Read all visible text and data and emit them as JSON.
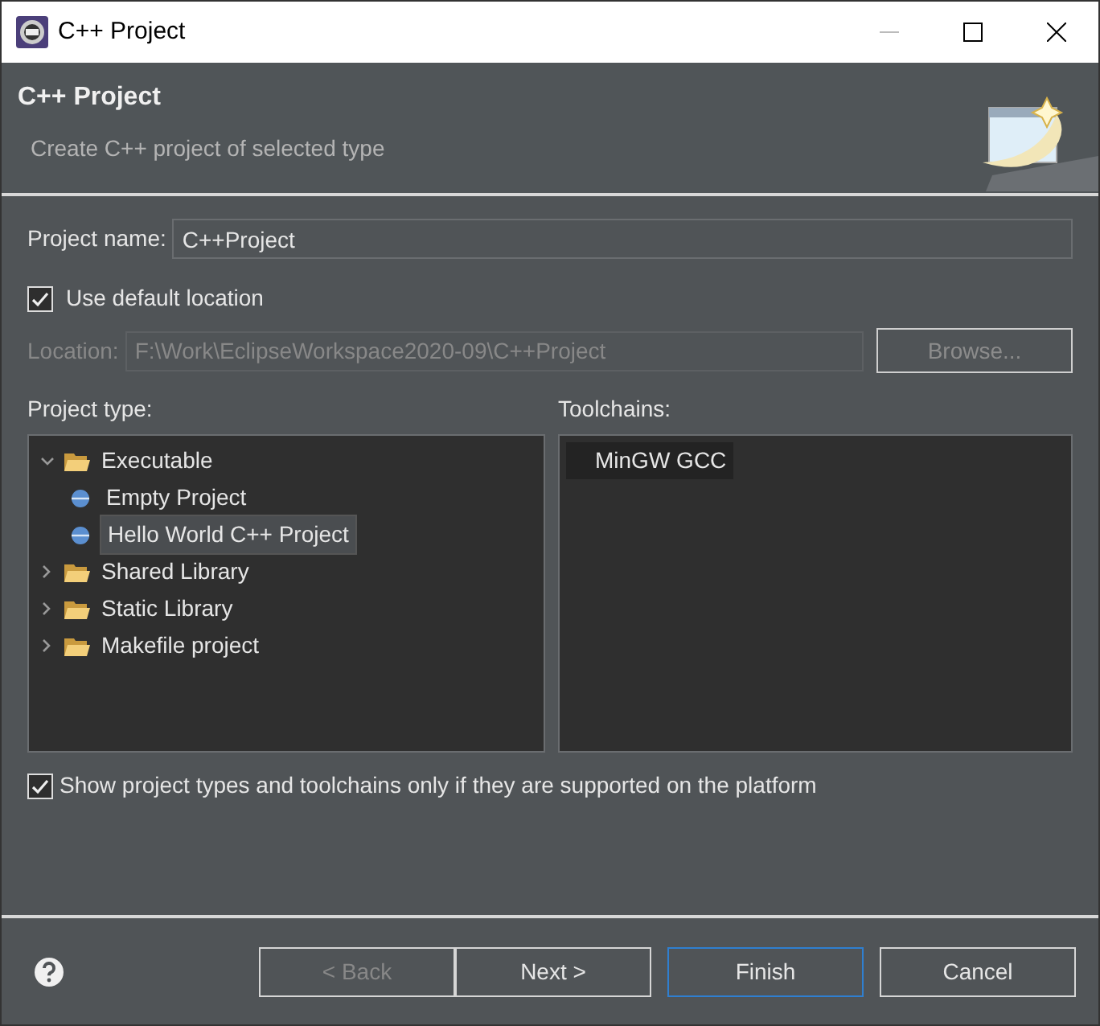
{
  "window": {
    "title": "C++ Project"
  },
  "header": {
    "title": "C++ Project",
    "description": "Create C++ project of selected type"
  },
  "project_name": {
    "label": "Project name:",
    "value": "C++Project"
  },
  "use_default_location": {
    "label": "Use default location",
    "checked": true
  },
  "location": {
    "label": "Location:",
    "value": "F:\\Work\\EclipseWorkspace2020-09\\C++Project",
    "disabled": true,
    "browse": "Browse..."
  },
  "project_type": {
    "label": "Project type:",
    "items": [
      {
        "kind": "folder",
        "label": "Executable",
        "expanded": true,
        "selected": false,
        "children": [
          {
            "kind": "template",
            "label": "Empty Project",
            "selected": false
          },
          {
            "kind": "template",
            "label": "Hello World C++ Project",
            "selected": true
          }
        ]
      },
      {
        "kind": "folder",
        "label": "Shared Library",
        "expanded": false,
        "selected": false
      },
      {
        "kind": "folder",
        "label": "Static Library",
        "expanded": false,
        "selected": false
      },
      {
        "kind": "folder",
        "label": "Makefile project",
        "expanded": false,
        "selected": false
      }
    ]
  },
  "toolchains": {
    "label": "Toolchains:",
    "items": [
      {
        "label": "MinGW GCC",
        "selected": true
      }
    ]
  },
  "show_supported": {
    "label": "Show project types and toolchains only if they are supported on the platform",
    "checked": true
  },
  "buttons": [
    {
      "label": "< Back",
      "disabled": true,
      "default": false
    },
    {
      "label": "Next >",
      "disabled": false,
      "default": false
    },
    {
      "label": "Finish",
      "disabled": false,
      "default": true
    },
    {
      "label": "Cancel",
      "disabled": false,
      "default": false
    }
  ]
}
